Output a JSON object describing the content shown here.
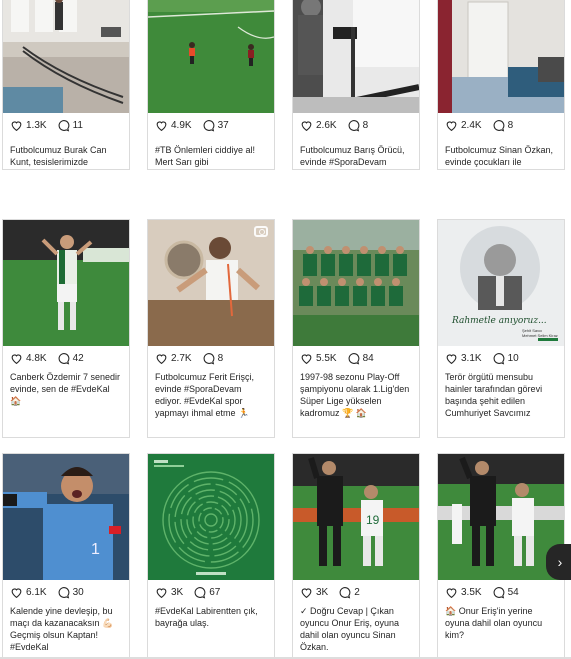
{
  "posts": [
    {
      "likes": "1.3K",
      "comments": "11",
      "caption": "Futbolcumuz Burak Can Kunt, tesislerimizde #SporaDevam ediyor. #EvdeKal spor yapmayı",
      "image": "gym-with-battle-ropes"
    },
    {
      "likes": "4.9K",
      "comments": "37",
      "caption": "#TB Önlemleri ciddiye al! Mert Sarı gibi #MesafeniKoru 🚀",
      "image": "football-pitch-players"
    },
    {
      "likes": "2.6K",
      "comments": "8",
      "caption": "Futbolcumuz Barış Örücü, evinde #SporaDevam ediyor. #EvdeKal spor yapmayı ihmal etme 🏃",
      "image": "treadmill-by-window"
    },
    {
      "likes": "2.4K",
      "comments": "8",
      "caption": "Futbolcumuz Sinan Özkan, evinde çocukları ile #SporaDevam ediyor. #EvdeKal spor yapmayı",
      "image": "living-room-exercise"
    },
    {
      "likes": "4.8K",
      "comments": "42",
      "caption": "Canberk Özdemir 7 senedir evinde, sen de #EvdeKal 🏠",
      "image": "player-celebrating-on-pitch"
    },
    {
      "likes": "2.7K",
      "comments": "8",
      "caption": "Futbolcumuz Ferit Erişçi, evinde #SporaDevam ediyor. #EvdeKal spor yapmayı ihmal etme 🏃",
      "image": "player-with-resistance-band",
      "video": true
    },
    {
      "likes": "5.5K",
      "comments": "84",
      "caption": "1997-98 sezonu Play-Off şampiyonu olarak 1.Lig'den Süper Lige yükselen kadromuz 🏆 🏠",
      "image": "team-photo-1997"
    },
    {
      "likes": "3.1K",
      "comments": "10",
      "caption": "Terör örgütü mensubu hainler tarafından görevi başında şehit edilen Cumhuriyet Savcımız",
      "image": "memorial-portrait",
      "overlay_text": "Rahmetle anıyoruz...",
      "overlay_sub": "Şehit Savcı\nMehmet Selim Kiraz"
    },
    {
      "likes": "6.1K",
      "comments": "30",
      "caption": "Kalende yine devleşip, bu maçı da kazanacaksın 💪🏻 Geçmiş olsun Kaptan! #EvdeKal",
      "image": "goalkeeper-shouting"
    },
    {
      "likes": "3K",
      "comments": "67",
      "caption": "#EvdeKal Labirentten çık, bayrağa ulaş.",
      "image": "green-maze"
    },
    {
      "likes": "3K",
      "comments": "2",
      "caption": "✓ Doğru Cevap | Çıkan oyuncu Onur Eriş, oyuna dahil olan oyuncu Sinan Özkan.",
      "image": "substitution-sideline"
    },
    {
      "likes": "3.5K",
      "comments": "54",
      "caption": "🏠 Onur Eriş'in yerine oyuna dahil olan oyuncu kim?",
      "image": "substitution-sideline-2"
    }
  ],
  "nav": {
    "next_icon": "chevron-right-icon",
    "next_glyph": "›"
  },
  "colors": {
    "brand_green": "#1f7a3c",
    "text": "#262626",
    "border": "#dbdbdb"
  }
}
